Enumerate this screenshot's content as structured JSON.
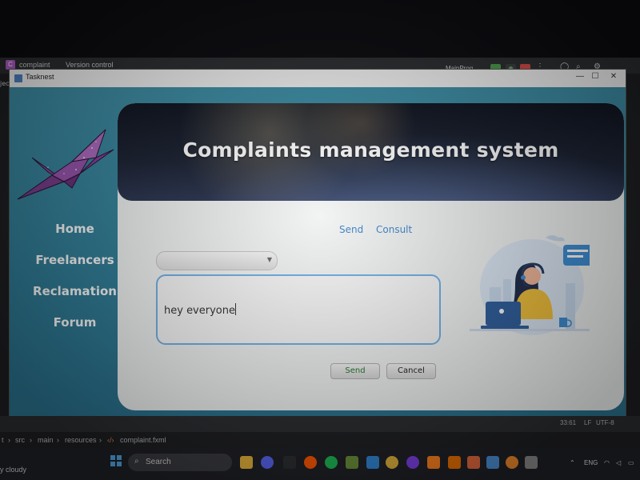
{
  "ide": {
    "project_badge": "C",
    "project_name": "complaint",
    "vcs_label": "Version control",
    "run_config": "MainProg",
    "left_label": "jec",
    "status": {
      "cursor_pos": "33:61",
      "line_sep": "LF",
      "encoding": "UTF-8"
    },
    "breadcrumb": [
      "t",
      "src",
      "main",
      "resources",
      "complaint.fxml"
    ]
  },
  "window": {
    "title": "Tasknest",
    "minimize": "—",
    "maximize": "☐",
    "close": "✕"
  },
  "sidebar": {
    "items": [
      {
        "label": "Home"
      },
      {
        "label": "Freelancers"
      },
      {
        "label": "Reclamation"
      },
      {
        "label": "Forum"
      }
    ]
  },
  "banner": {
    "title": "Complaints management system"
  },
  "tabs": [
    {
      "label": "Send"
    },
    {
      "label": "Consult"
    }
  ],
  "form": {
    "combo_value": "",
    "message": "hey everyone",
    "send_label": "Send",
    "cancel_label": "Cancel"
  },
  "taskbar": {
    "weather": "y cloudy",
    "search_label": "Search",
    "language": "ENG"
  },
  "colors": {
    "sidebar_bg": "#3c8aa0",
    "link": "#3f86c9",
    "send_text": "#1f7a2a",
    "input_border": "#6fb1e6"
  },
  "icons": {
    "logo": "origami-crane-icon",
    "illustration": "support-agent-illustration"
  }
}
